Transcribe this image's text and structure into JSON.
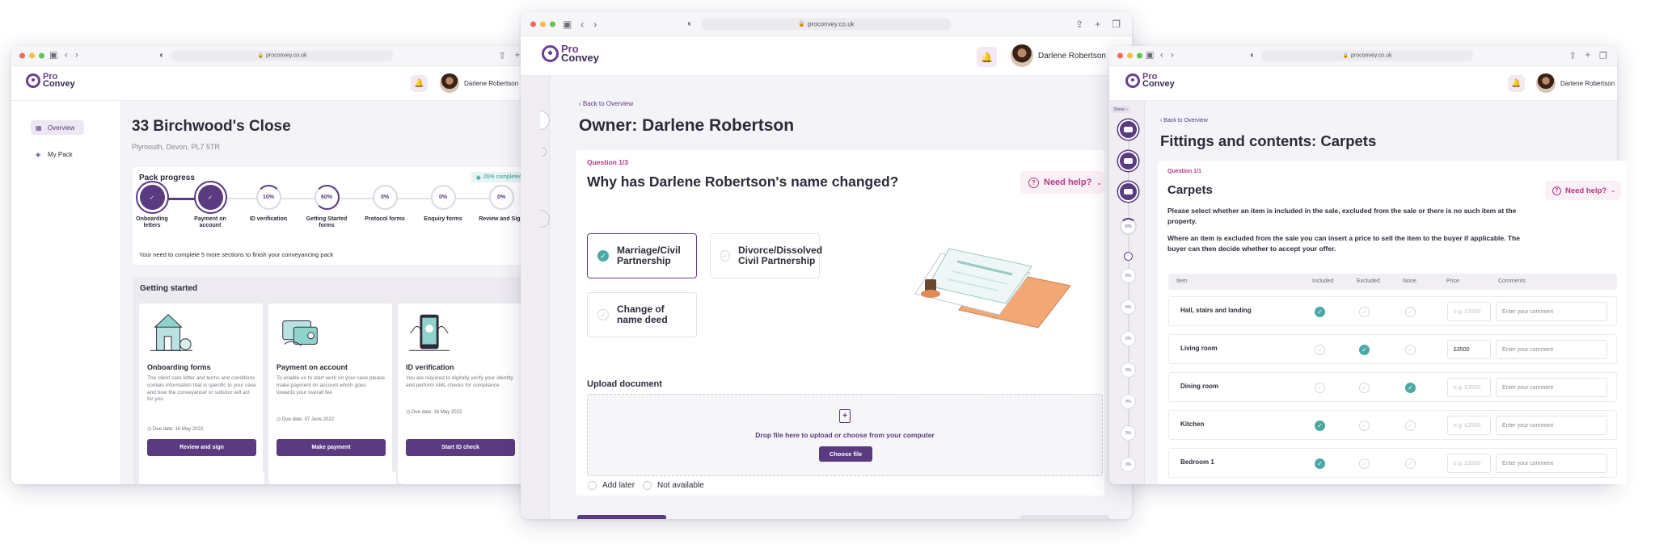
{
  "browser": {
    "url": "proconvey.co.uk"
  },
  "brand": {
    "line1": "Pro",
    "line2": "Convey"
  },
  "user": {
    "name": "Darlene Robertson"
  },
  "colors": {
    "primary": "#5a3a80",
    "accent": "#b23a86",
    "check": "#4aa8a6",
    "progress_badge": "#2e9a8f"
  },
  "overview": {
    "sidebar": [
      {
        "label": "Overview",
        "icon": "grid-icon"
      },
      {
        "label": "My Pack",
        "icon": "layers-icon"
      }
    ],
    "title": "33 Birchwood's Close",
    "address": "Plymouth, Devon, PL7 5TR",
    "progress": {
      "title": "Pack progress",
      "badge": "26% completed",
      "note": "Your need to complete 5 more sections to finish your conveyancing pack",
      "steps": [
        {
          "label": "Onboarding letters",
          "status": "done",
          "value": ""
        },
        {
          "label": "Payment on account",
          "status": "done",
          "value": ""
        },
        {
          "label": "ID verification",
          "status": "partial",
          "value": "10%"
        },
        {
          "label": "Getting Started forms",
          "status": "partial",
          "value": "60%"
        },
        {
          "label": "Protocol forms",
          "status": "pending",
          "value": "0%"
        },
        {
          "label": "Enquiry forms",
          "status": "pending",
          "value": "0%"
        },
        {
          "label": "Review and Sign",
          "status": "pending",
          "value": "0%"
        }
      ]
    },
    "getting_started": {
      "title": "Getting started",
      "cards": [
        {
          "title": "Onboarding forms",
          "desc": "The client care letter and terms and conditions contain information that is specific to your case and how the conveyancer or solicitor will act for you",
          "due": "Due date: 16 May 2022",
          "button": "Review and sign"
        },
        {
          "title": "Payment on account",
          "desc": "To enable us to start work on your case please make payment on account which goes towards your overall fee",
          "due": "Due date: 07 June 2022",
          "button": "Make payment"
        },
        {
          "title": "ID verification",
          "desc": "You are required to digitally verify your identity and perform AML checks for compliance",
          "due": "Due date: 16 May 2022",
          "button": "Start ID check"
        }
      ]
    }
  },
  "owner": {
    "back": "Back to Overview",
    "title": "Owner: Darlene Robertson",
    "question_label": "Question 1/3",
    "question": "Why has Darlene Robertson's name changed?",
    "help": "Need help?",
    "options": [
      {
        "label": "Marriage/Civil Partnership",
        "selected": true
      },
      {
        "label": "Divorce/Dissolved Civil Partnership",
        "selected": false
      },
      {
        "label": "Change of name deed",
        "selected": false
      }
    ],
    "upload": {
      "title": "Upload document",
      "drop_text": "Drop file here to upload or choose from your computer",
      "button": "Choose file"
    },
    "footer_options": [
      "Add later",
      "Not available"
    ]
  },
  "fittings": {
    "show_label": "Show",
    "back": "Back to Overview",
    "title": "Fittings and contents: Carpets",
    "question_label": "Question 1/1",
    "section": "Carpets",
    "help": "Need help?",
    "para1": "Please select whether an item is included in the sale, excluded from the sale or there is no such item at the property.",
    "para2": "Where an item is excluded from the sale you can insert a price to sell the item to the buyer if applicable. The buyer can then decide whether to accept your offer.",
    "rail_labels": [
      "0%",
      "0%",
      "0%",
      "0%",
      "0%",
      "0%",
      "0%",
      "0%",
      "0%"
    ],
    "columns": [
      "Item",
      "Included",
      "Excluded",
      "None",
      "Price",
      "Comments"
    ],
    "rows": [
      {
        "item": "Hall, stairs and landing",
        "choice": "included",
        "price": "",
        "comment": ""
      },
      {
        "item": "Living room",
        "choice": "excluded",
        "price": "£3500",
        "comment": ""
      },
      {
        "item": "Dining room",
        "choice": "none",
        "price": "",
        "comment": ""
      },
      {
        "item": "Kitchen",
        "choice": "included",
        "price": "",
        "comment": ""
      },
      {
        "item": "Bedroom 1",
        "choice": "included",
        "price": "",
        "comment": ""
      }
    ],
    "price_placeholder": "e.g. £3500",
    "comment_placeholder": "Enter your comment"
  }
}
